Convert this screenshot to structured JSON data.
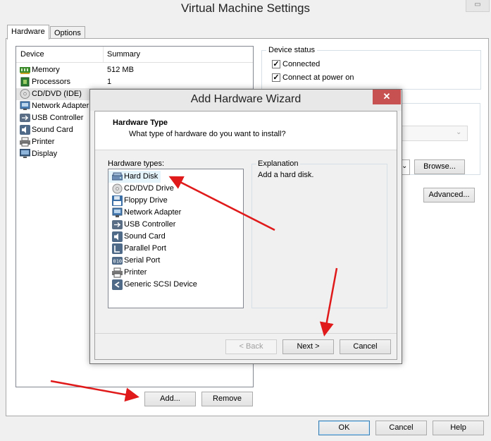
{
  "window": {
    "title": "Virtual Machine Settings"
  },
  "tabs": [
    {
      "label": "Hardware"
    },
    {
      "label": "Options"
    }
  ],
  "device_list": {
    "columns": {
      "device": "Device",
      "summary": "Summary"
    },
    "rows": [
      {
        "name": "Memory",
        "summary": "512 MB",
        "icon": "memory-icon"
      },
      {
        "name": "Processors",
        "summary": "1",
        "icon": "processor-icon"
      },
      {
        "name": "CD/DVD (IDE)",
        "summary": "",
        "icon": "cd-dvd-icon"
      },
      {
        "name": "Network Adapter",
        "summary": "",
        "icon": "network-adapter-icon"
      },
      {
        "name": "USB Controller",
        "summary": "",
        "icon": "usb-icon"
      },
      {
        "name": "Sound Card",
        "summary": "",
        "icon": "sound-card-icon"
      },
      {
        "name": "Printer",
        "summary": "",
        "icon": "printer-icon"
      },
      {
        "name": "Display",
        "summary": "",
        "icon": "display-icon"
      }
    ]
  },
  "device_status": {
    "title": "Device status",
    "connected": {
      "label": "Connected",
      "checked": true
    },
    "connect_at_power_on": {
      "label": "Connect at power on",
      "checked": true
    }
  },
  "right_buttons": {
    "browse": "Browse...",
    "advanced": "Advanced..."
  },
  "bottom_buttons": {
    "add": "Add...",
    "remove": "Remove",
    "ok": "OK",
    "cancel": "Cancel",
    "help": "Help"
  },
  "wizard": {
    "title": "Add Hardware Wizard",
    "close": "✕",
    "heading": "Hardware Type",
    "subheading": "What type of hardware do you want to install?",
    "types_label": "Hardware types:",
    "types": [
      {
        "name": "Hard Disk",
        "icon": "hard-disk-icon",
        "selected": true
      },
      {
        "name": "CD/DVD Drive",
        "icon": "cd-dvd-icon"
      },
      {
        "name": "Floppy Drive",
        "icon": "floppy-drive-icon"
      },
      {
        "name": "Network Adapter",
        "icon": "network-adapter-icon"
      },
      {
        "name": "USB Controller",
        "icon": "usb-icon"
      },
      {
        "name": "Sound Card",
        "icon": "sound-card-icon"
      },
      {
        "name": "Parallel Port",
        "icon": "parallel-port-icon"
      },
      {
        "name": "Serial Port",
        "icon": "serial-port-icon"
      },
      {
        "name": "Printer",
        "icon": "printer-icon"
      },
      {
        "name": "Generic SCSI Device",
        "icon": "scsi-device-icon"
      }
    ],
    "explanation_label": "Explanation",
    "explanation_text": "Add a hard disk.",
    "buttons": {
      "back": "< Back",
      "next": "Next >",
      "cancel": "Cancel"
    }
  },
  "colors": {
    "annotation_arrow": "#e01a1a",
    "close_button": "#c75050",
    "selection": "#e5f3fb"
  }
}
